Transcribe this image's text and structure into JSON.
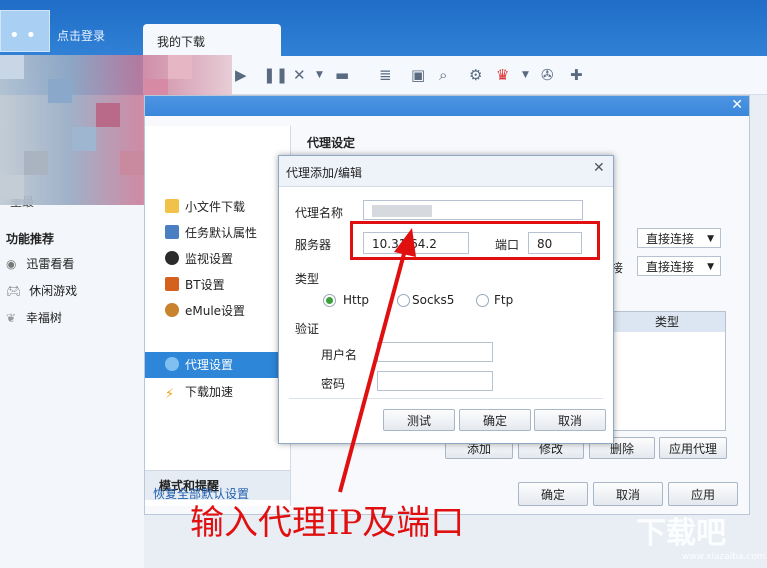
{
  "topbar": {
    "login_label": "点击登录",
    "tab_label": "我的下载"
  },
  "left_panel": {
    "partial_text": "里最",
    "section_title": "功能推荐",
    "items": [
      {
        "label": "迅雷看看",
        "icon": "eye-icon"
      },
      {
        "label": "休闲游戏",
        "icon": "gamepad-icon"
      },
      {
        "label": "幸福树",
        "icon": "leaf-icon"
      }
    ]
  },
  "settings": {
    "nav_items": [
      {
        "label": "小文件下载",
        "icon": "folder-icon"
      },
      {
        "label": "任务默认属性",
        "icon": "list-icon"
      },
      {
        "label": "监视设置",
        "icon": "monitor-icon"
      },
      {
        "label": "BT设置",
        "icon": "bt-icon"
      },
      {
        "label": "eMule设置",
        "icon": "emule-icon"
      },
      {
        "label": "代理设置",
        "icon": "proxy-icon"
      },
      {
        "label": "下载加速",
        "icon": "lightning-icon"
      }
    ],
    "mode_section": "模式和提醒",
    "panel_title": "代理设定",
    "select1_value": "直接连接",
    "select2_prefix": "接",
    "select2_value": "直接连接",
    "list_header": "类型",
    "buttons": {
      "add": "添加",
      "edit": "修改",
      "delete": "删除",
      "apply_proxy": "应用代理"
    },
    "restore_link": "恢复全部默认设置",
    "ok": "确定",
    "cancel": "取消",
    "apply": "应用"
  },
  "proxy_dialog": {
    "title": "代理添加/编辑",
    "name_label": "代理名称",
    "server_label": "服务器",
    "server_value": "10.31.64.2",
    "port_label": "端口",
    "port_value": "80",
    "type_label": "类型",
    "types": [
      {
        "label": "Http",
        "selected": true
      },
      {
        "label": "Socks5",
        "selected": false
      },
      {
        "label": "Ftp",
        "selected": false
      }
    ],
    "auth_label": "验证",
    "user_label": "用户名",
    "password_label": "密码",
    "test_button": "测试",
    "ok_button": "确定",
    "cancel_button": "取消"
  },
  "annotation": {
    "caption": "输入代理IP及端口",
    "color": "#e01010"
  },
  "watermark": {
    "text": "下载吧",
    "url": "www.xiazaiba.com"
  }
}
